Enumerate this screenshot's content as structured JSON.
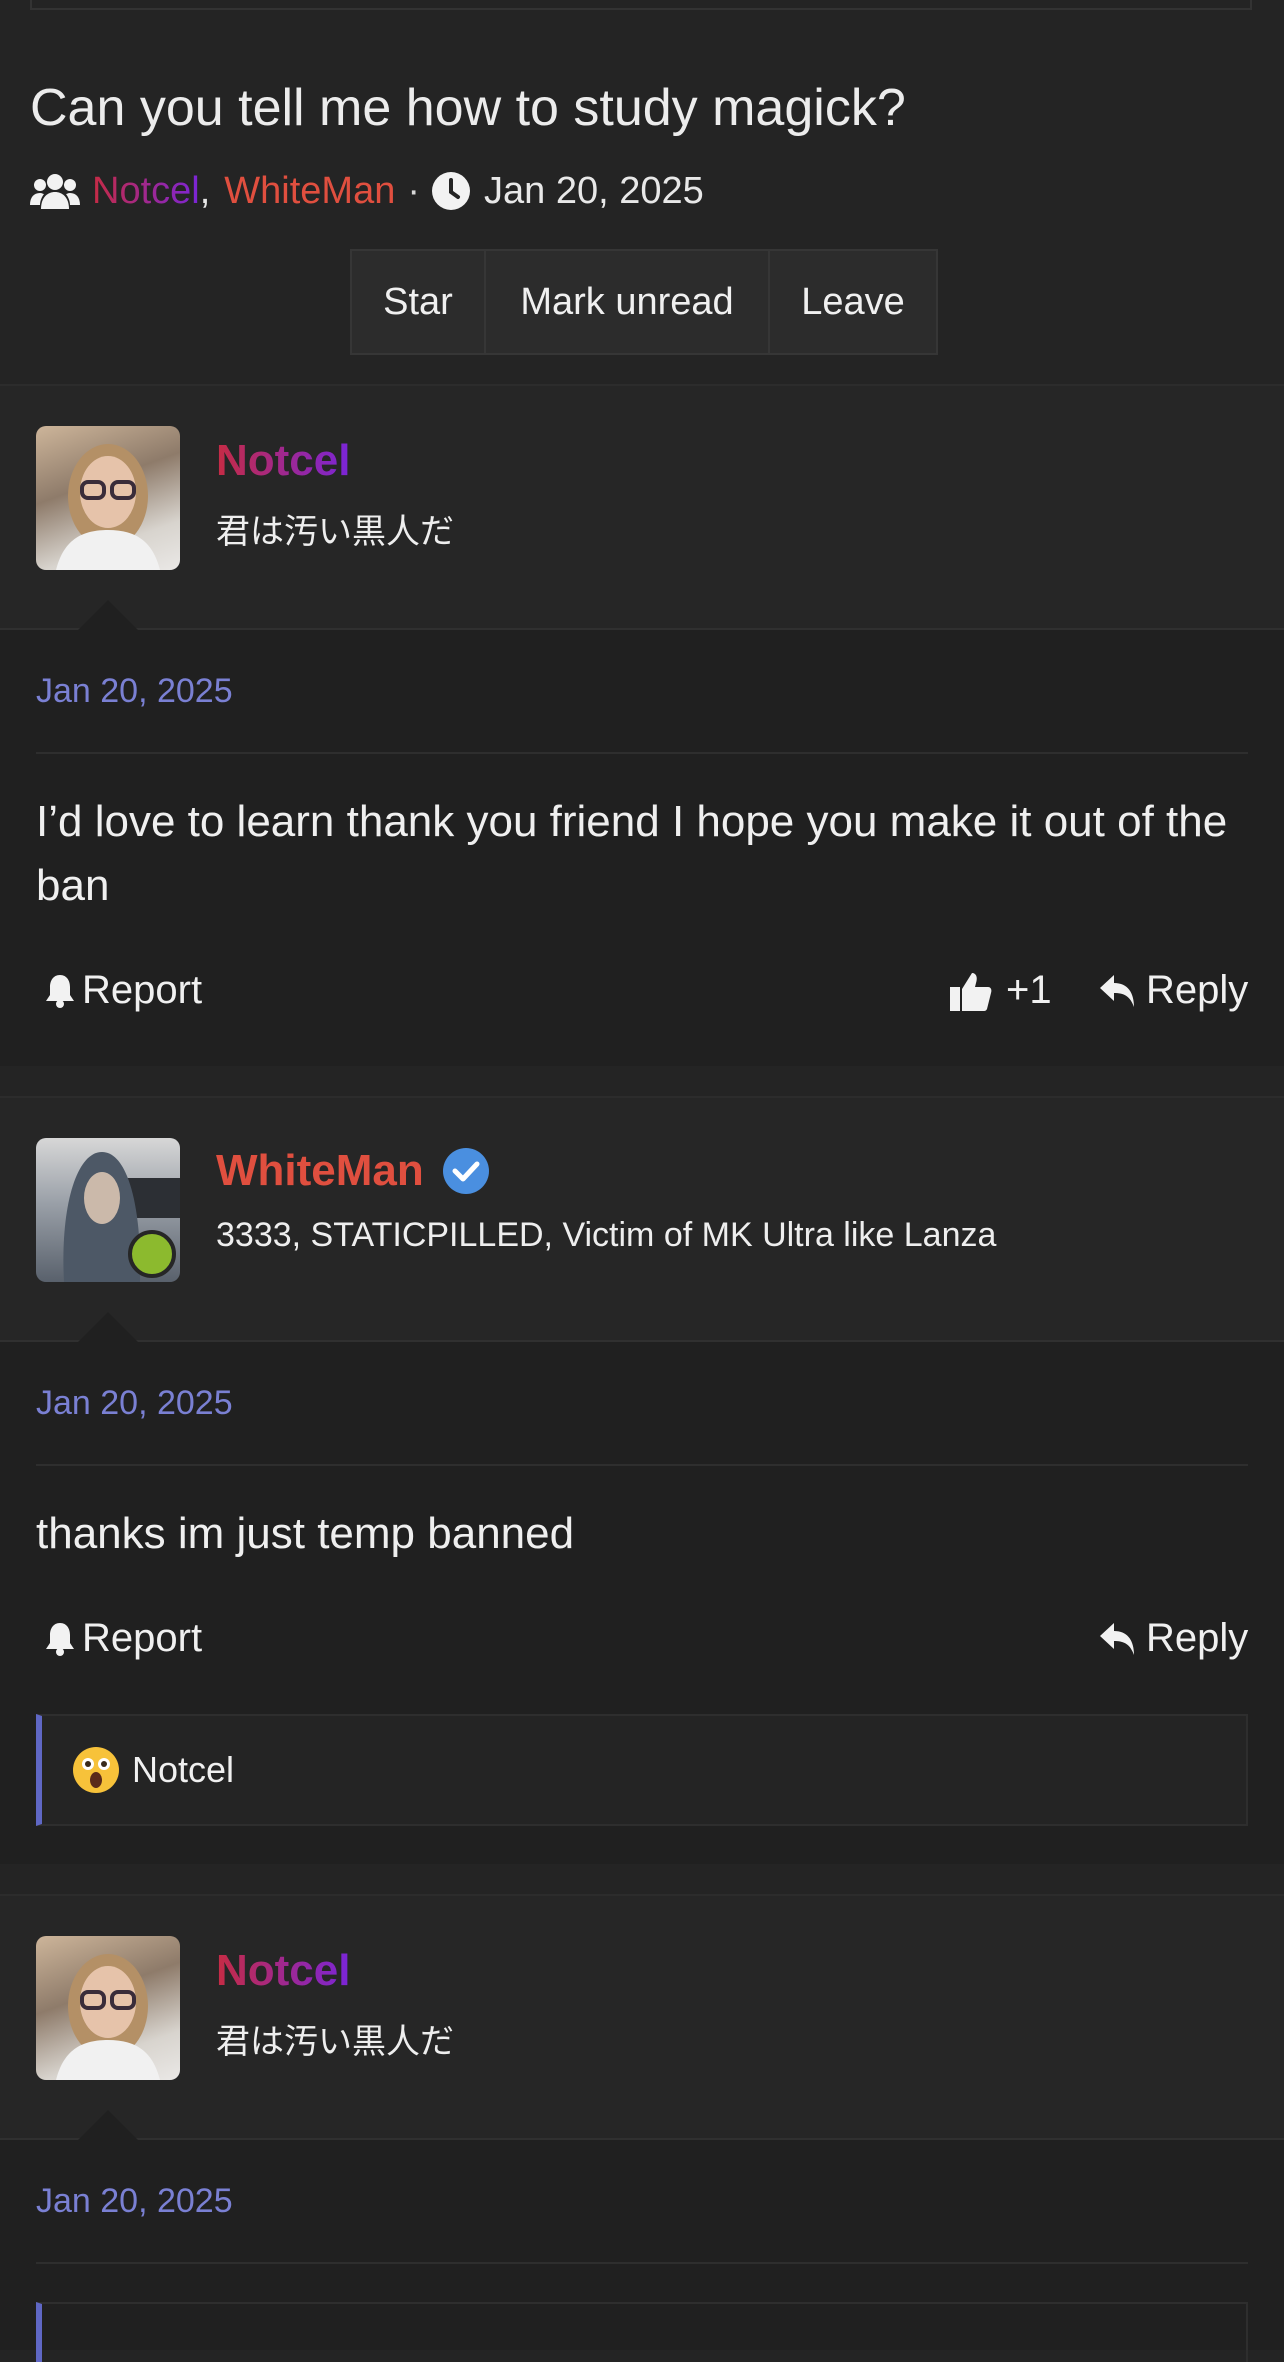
{
  "thread": {
    "title": "Can you tell me how to study magick?",
    "participant_1": "Notcel",
    "participant_separator": ",",
    "participant_2": "WhiteMan",
    "dot": "·",
    "date": "Jan 20, 2025",
    "icons": [
      "users-icon",
      "clock-icon"
    ]
  },
  "toolbar": {
    "star": "Star",
    "mark_unread": "Mark unread",
    "leave": "Leave"
  },
  "colors": {
    "link_blue": "#7a80d3",
    "whiteman_red": "#e04f3f",
    "notcel_gradient": [
      "#c62b44",
      "#7a25d8"
    ],
    "verified_blue": "#4a8fe0",
    "online_green": "#8cba2e"
  },
  "posts": [
    {
      "author": "Notcel",
      "user_title": "君は汚い黒人だ",
      "date": "Jan 20, 2025",
      "body": "I’d love to learn thank you friend I hope you make it out of the ban",
      "report": "Report",
      "likes": "+1",
      "reply": "Reply"
    },
    {
      "author": "WhiteMan",
      "verified": true,
      "online": true,
      "user_title": "3333, STATICPILLED, Victim of MK Ultra like Lanza",
      "date": "Jan 20, 2025",
      "body": "thanks im just temp banned",
      "report": "Report",
      "reply": "Reply",
      "reaction": {
        "emoji": "astonished-face",
        "user": "Notcel"
      }
    },
    {
      "author": "Notcel",
      "user_title": "君は汚い黒人だ",
      "date": "Jan 20, 2025"
    }
  ]
}
